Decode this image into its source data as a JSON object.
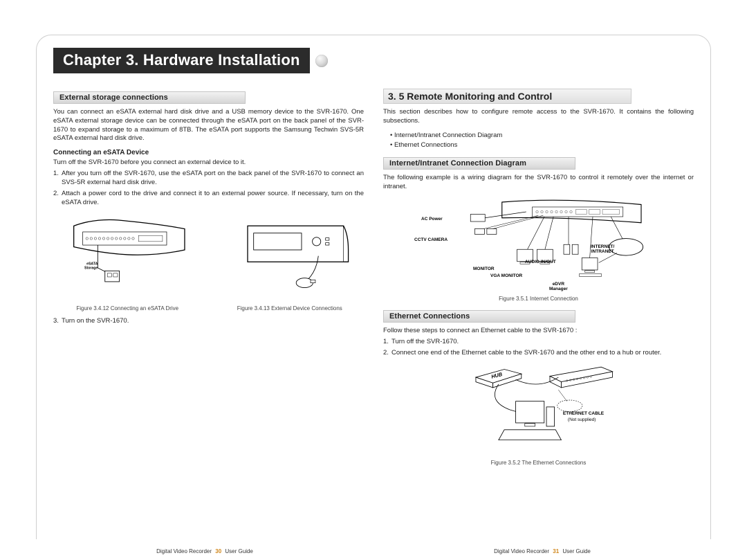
{
  "chapter_title": "Chapter 3. Hardware Installation",
  "left": {
    "subsection_title": "External storage connections",
    "intro": "You can connect an eSATA external hard disk drive and a USB memory device to the SVR-1670. One eSATA external storage device can be connected through the eSATA port on the back panel of the SVR-1670 to expand storage to a maximum of 8TB. The eSATA port supports the Samsung Techwin SVS-5R eSATA external hard disk drive.",
    "heading2": "Connecting an eSATA Device",
    "preline": "Turn off the SVR-1670 before you connect an external device to it.",
    "step1_num": "1.",
    "step1": "After you turn off the SVR-1670, use the eSATA port on the back panel of the SVR-1670 to connect an SVS-5R external hard disk drive.",
    "step2_num": "2.",
    "step2": "Attach a power cord to the drive and connect it to an external power source. If necessary, turn on the eSATA drive.",
    "fig1_caption": "Figure 3.4.12 Connecting an eSATA Drive",
    "fig1_label": "eSATA\nStorage",
    "fig2_caption": "Figure 3.4.13 External Device Connections",
    "step3_num": "3.",
    "step3": "Turn on the SVR-1670."
  },
  "right": {
    "section_num": "3. 5 Remote Monitoring and Control",
    "intro": "This section describes how to configure remote access to the SVR-1670. It contains the following subsections.",
    "bullets": [
      "Internet/Intranet Connection Diagram",
      "Ethernet Connections"
    ],
    "sub1_title": "Internet/Intranet Connection Diagram",
    "sub1_text": "The following example is a wiring diagram for the SVR-1670 to control it remotely over the internet or intranet.",
    "diag_labels": {
      "ac": "AC Power",
      "cctv": "CCTV CAMERA",
      "monitor": "MONITOR",
      "vga": "VGA MONITOR",
      "audio": "AUDIO IN/OUT",
      "edvr": "eDVR\nManager",
      "internet": "INTERNET/\nINTRANET"
    },
    "fig3_caption": "Figure 3.5.1 Internet Connection",
    "sub2_title": "Ethernet Connections",
    "sub2_text1": "Follow these steps to connect an Ethernet cable to the SVR-1670 :",
    "sub2_step1_num": "1.",
    "sub2_step1": "Turn off the SVR-1670.",
    "sub2_step2_num": "2.",
    "sub2_step2": "Connect one end of the Ethernet cable to the SVR-1670 and the other end to a hub or router.",
    "eth_labels": {
      "hub": "HUB",
      "cable": "ETHERNET CABLE",
      "note": "(Not supplied)"
    },
    "fig4_caption": "Figure 3.5.2 The Ethernet Connections"
  },
  "footer": {
    "left_pre": "Digital Video Recorder",
    "left_page": "30",
    "left_post": "User Guide",
    "right_pre": "Digital Video Recorder",
    "right_page": "31",
    "right_post": "User Guide"
  }
}
